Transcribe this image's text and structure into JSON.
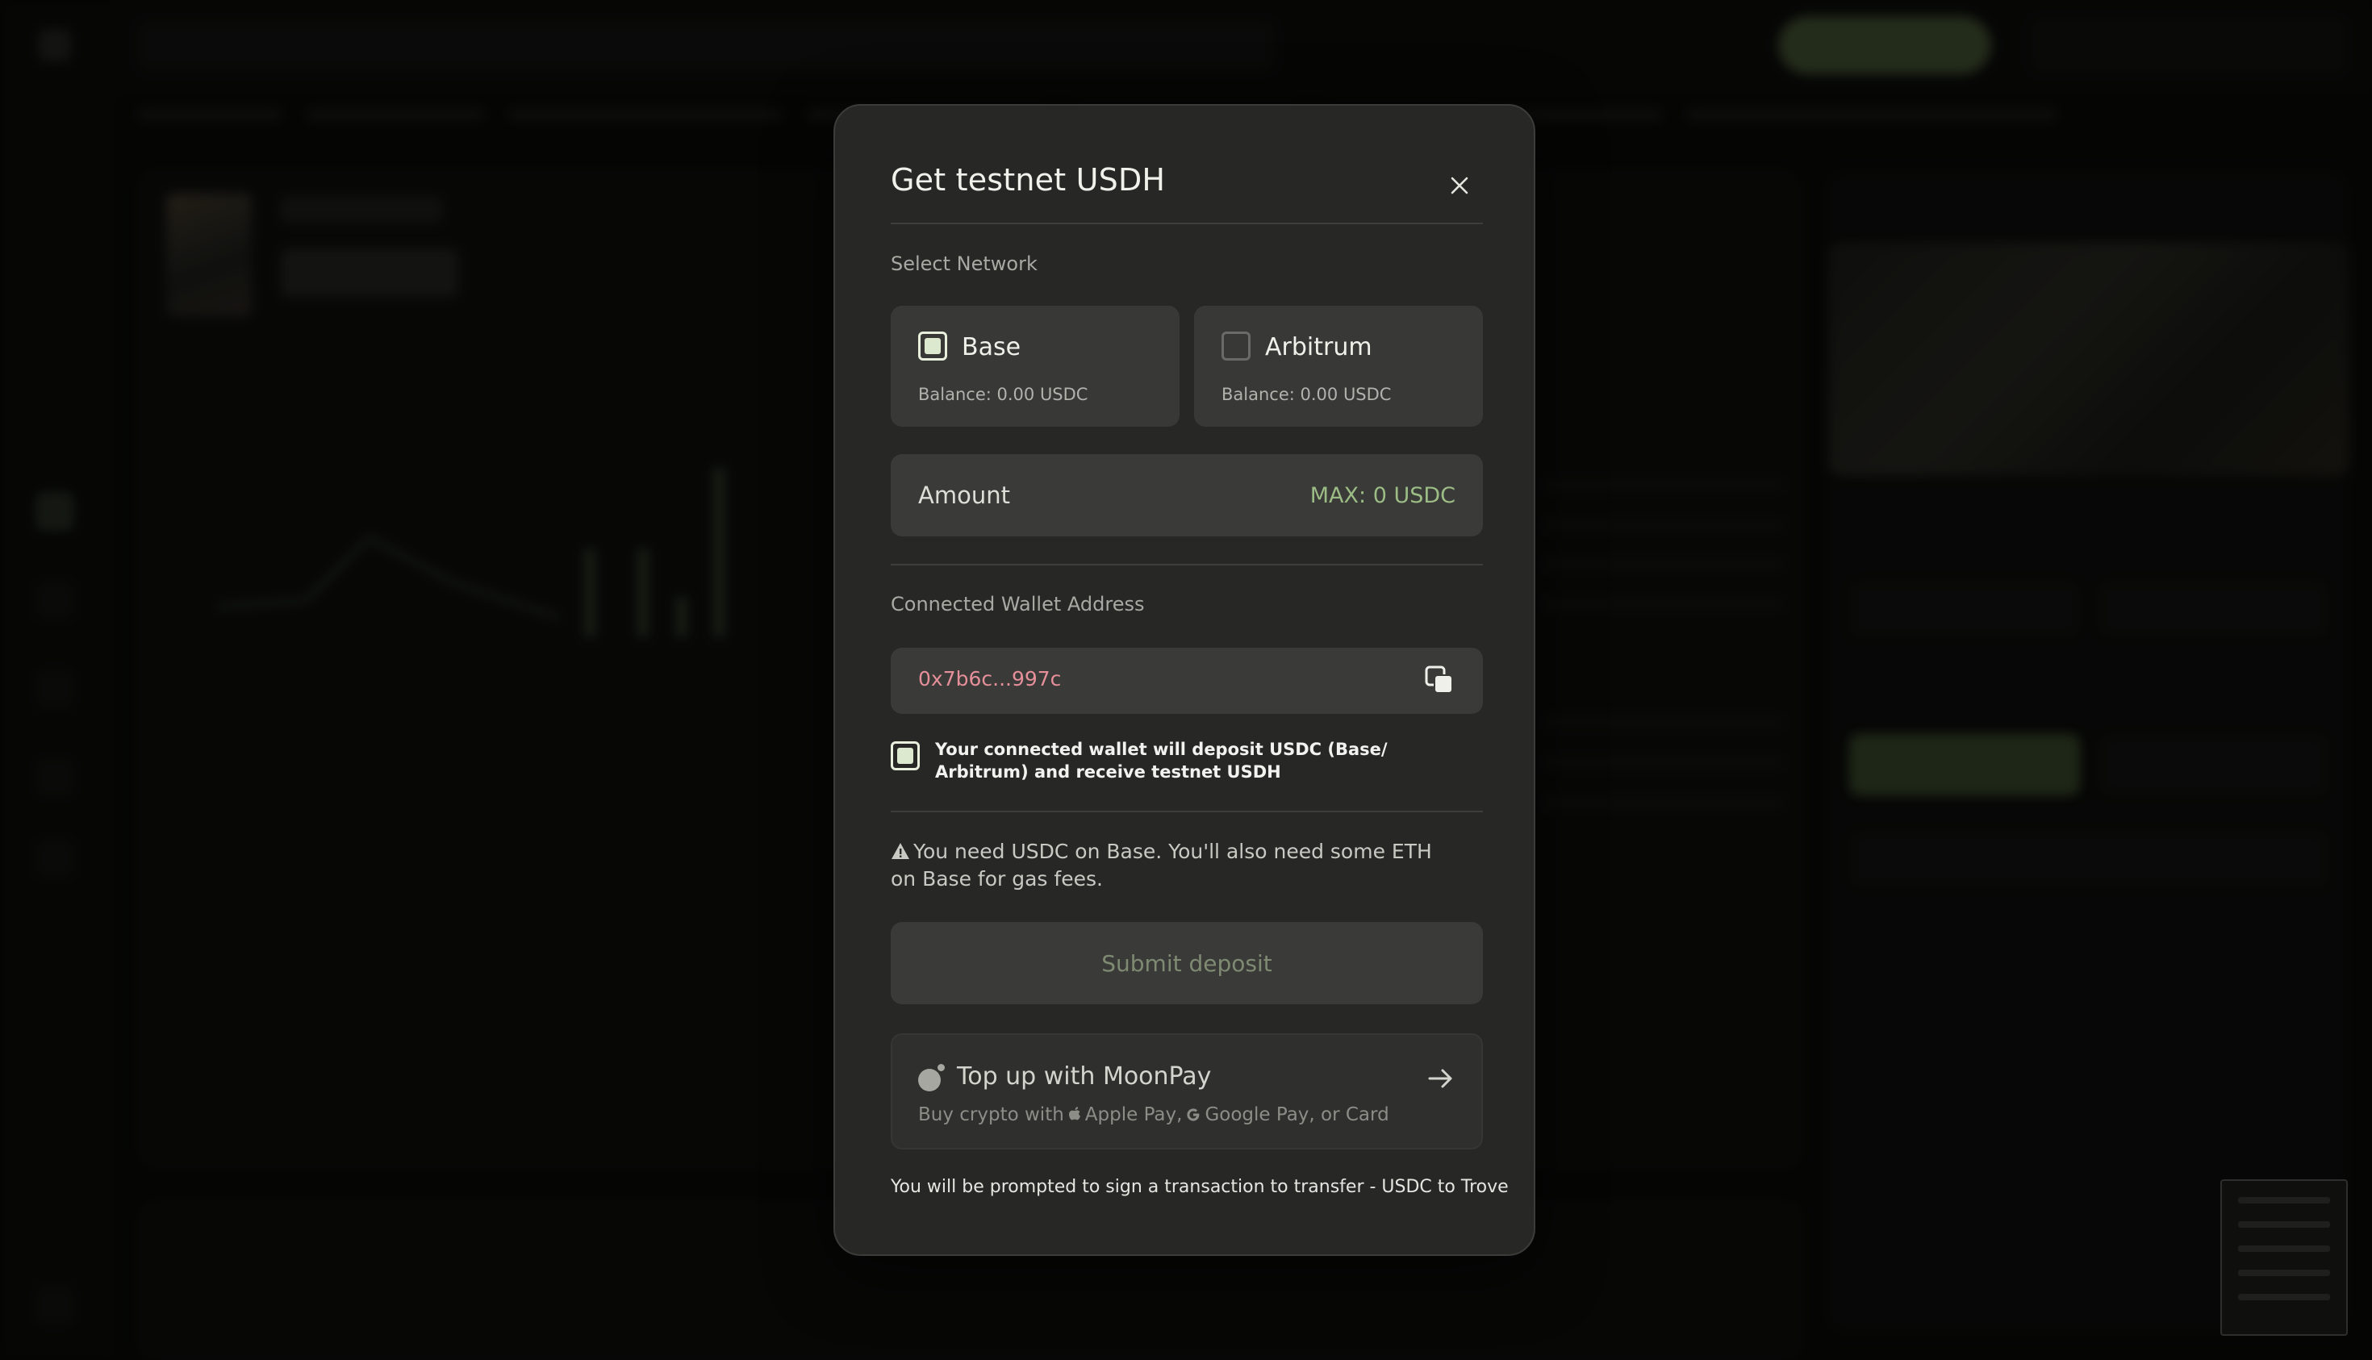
{
  "modal": {
    "title": "Get testnet USDH",
    "select_network_label": "Select Network",
    "networks": [
      {
        "name": "Base",
        "balance": "Balance: 0.00 USDC",
        "selected": true
      },
      {
        "name": "Arbitrum",
        "balance": "Balance: 0.00 USDC",
        "selected": false
      }
    ],
    "amount": {
      "placeholder": "Amount",
      "max_label": "MAX: 0 USDC"
    },
    "wallet": {
      "label": "Connected Wallet Address",
      "address": "0x7b6c...997c"
    },
    "consent": {
      "checked": true,
      "text": "Your connected wallet will deposit USDC (Base/ Arbitrum) and receive testnet USDH"
    },
    "warning": "You need USDC on Base. You'll also need some ETH on Base for gas fees.",
    "submit_label": "Submit deposit",
    "moonpay": {
      "title": "Top up with MoonPay",
      "sub_prefix": "Buy crypto with",
      "apple_pay": "Apple Pay,",
      "google_pay": "Google Pay, or Card"
    },
    "footnote": "You will be prompted to sign a transaction to transfer - USDC to Trove"
  },
  "colors": {
    "accent_green": "#9cbc86",
    "address_pink": "#e58f9a",
    "modal_bg": "#272725"
  },
  "icons": [
    "close-icon",
    "copy-icon",
    "warning-icon",
    "moonpay-icon",
    "apple-icon",
    "google-icon",
    "arrow-right-icon"
  ]
}
